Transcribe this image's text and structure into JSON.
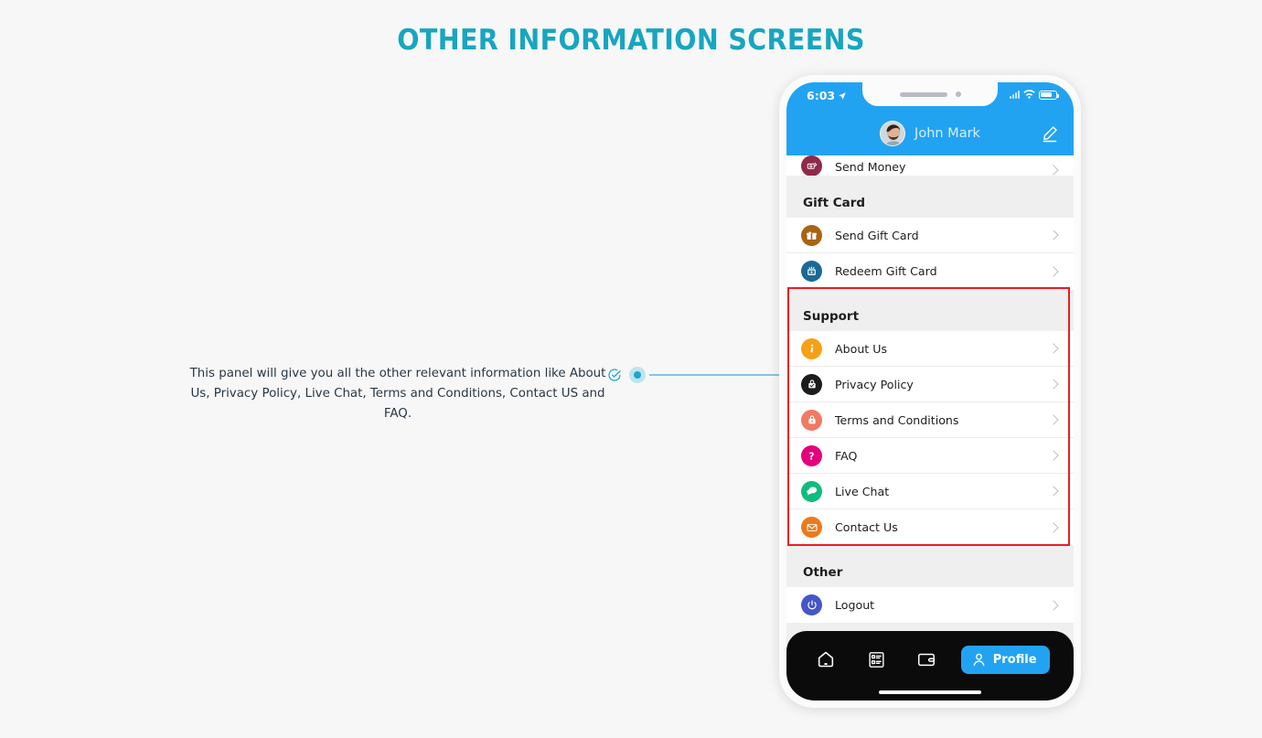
{
  "page": {
    "title": "OTHER INFORMATION SCREENS",
    "title_color": "#18a5c0",
    "background": "#f7f7f7"
  },
  "annotation": {
    "text": "This panel will give you all the other relevant information like About Us, Privacy Policy, Live Chat, Terms and Conditions, Contact US and FAQ.",
    "check_icon": "check-circle-icon",
    "marker_icon": "dot-marker-icon",
    "connector_color": "#7ec8de",
    "marker_color": "#1ba7d0"
  },
  "highlight": {
    "color": "#ee1b24",
    "target_section": "Support"
  },
  "phone": {
    "statusbar": {
      "time": "6:03",
      "location_icon": "location-arrow-icon",
      "signal_icon": "cellular-signal-icon",
      "wifi_icon": "wifi-icon",
      "battery_icon": "battery-icon"
    },
    "header": {
      "accent": "#22a3f2",
      "avatar_icon": "user-avatar",
      "user_name": "John Mark",
      "edit_label": "edit-profile",
      "edit_icon": "pencil-edit-icon"
    },
    "sections": [
      {
        "id": "send-money-partial",
        "heading": null,
        "items": [
          {
            "label": "Send Money",
            "icon": "send-money-icon",
            "color": "#8e2a4a",
            "clipped": true
          }
        ]
      },
      {
        "id": "gift-card",
        "heading": "Gift Card",
        "items": [
          {
            "label": "Send Gift Card",
            "icon": "gift-icon",
            "color": "#a96312"
          },
          {
            "label": "Redeem Gift Card",
            "icon": "redeem-gift-icon",
            "color": "#1a6a94"
          }
        ]
      },
      {
        "id": "support",
        "heading": "Support",
        "items": [
          {
            "label": "About Us",
            "icon": "info-icon",
            "color": "#f5a118"
          },
          {
            "label": "Privacy Policy",
            "icon": "privacy-lock-check-icon",
            "color": "#1c1c1c"
          },
          {
            "label": "Terms and Conditions",
            "icon": "terms-lock-icon",
            "color": "#f07a63"
          },
          {
            "label": "FAQ",
            "icon": "question-mark-icon",
            "color": "#e4007d"
          },
          {
            "label": "Live Chat",
            "icon": "chat-bubble-icon",
            "color": "#0fbc7e"
          },
          {
            "label": "Contact Us",
            "icon": "envelope-icon",
            "color": "#ec7a1c"
          }
        ]
      },
      {
        "id": "other",
        "heading": "Other",
        "items": [
          {
            "label": "Logout",
            "icon": "power-off-icon",
            "color": "#4656c7"
          }
        ]
      }
    ],
    "tabbar": {
      "items": [
        {
          "label": "Home",
          "icon": "home-icon",
          "active": false
        },
        {
          "label": "Transactions",
          "icon": "list-checklist-icon",
          "active": false
        },
        {
          "label": "Wallet",
          "icon": "wallet-icon",
          "active": false
        }
      ],
      "active_tab": {
        "label": "Profile",
        "icon": "person-icon",
        "color": "#22a3f2"
      }
    }
  }
}
